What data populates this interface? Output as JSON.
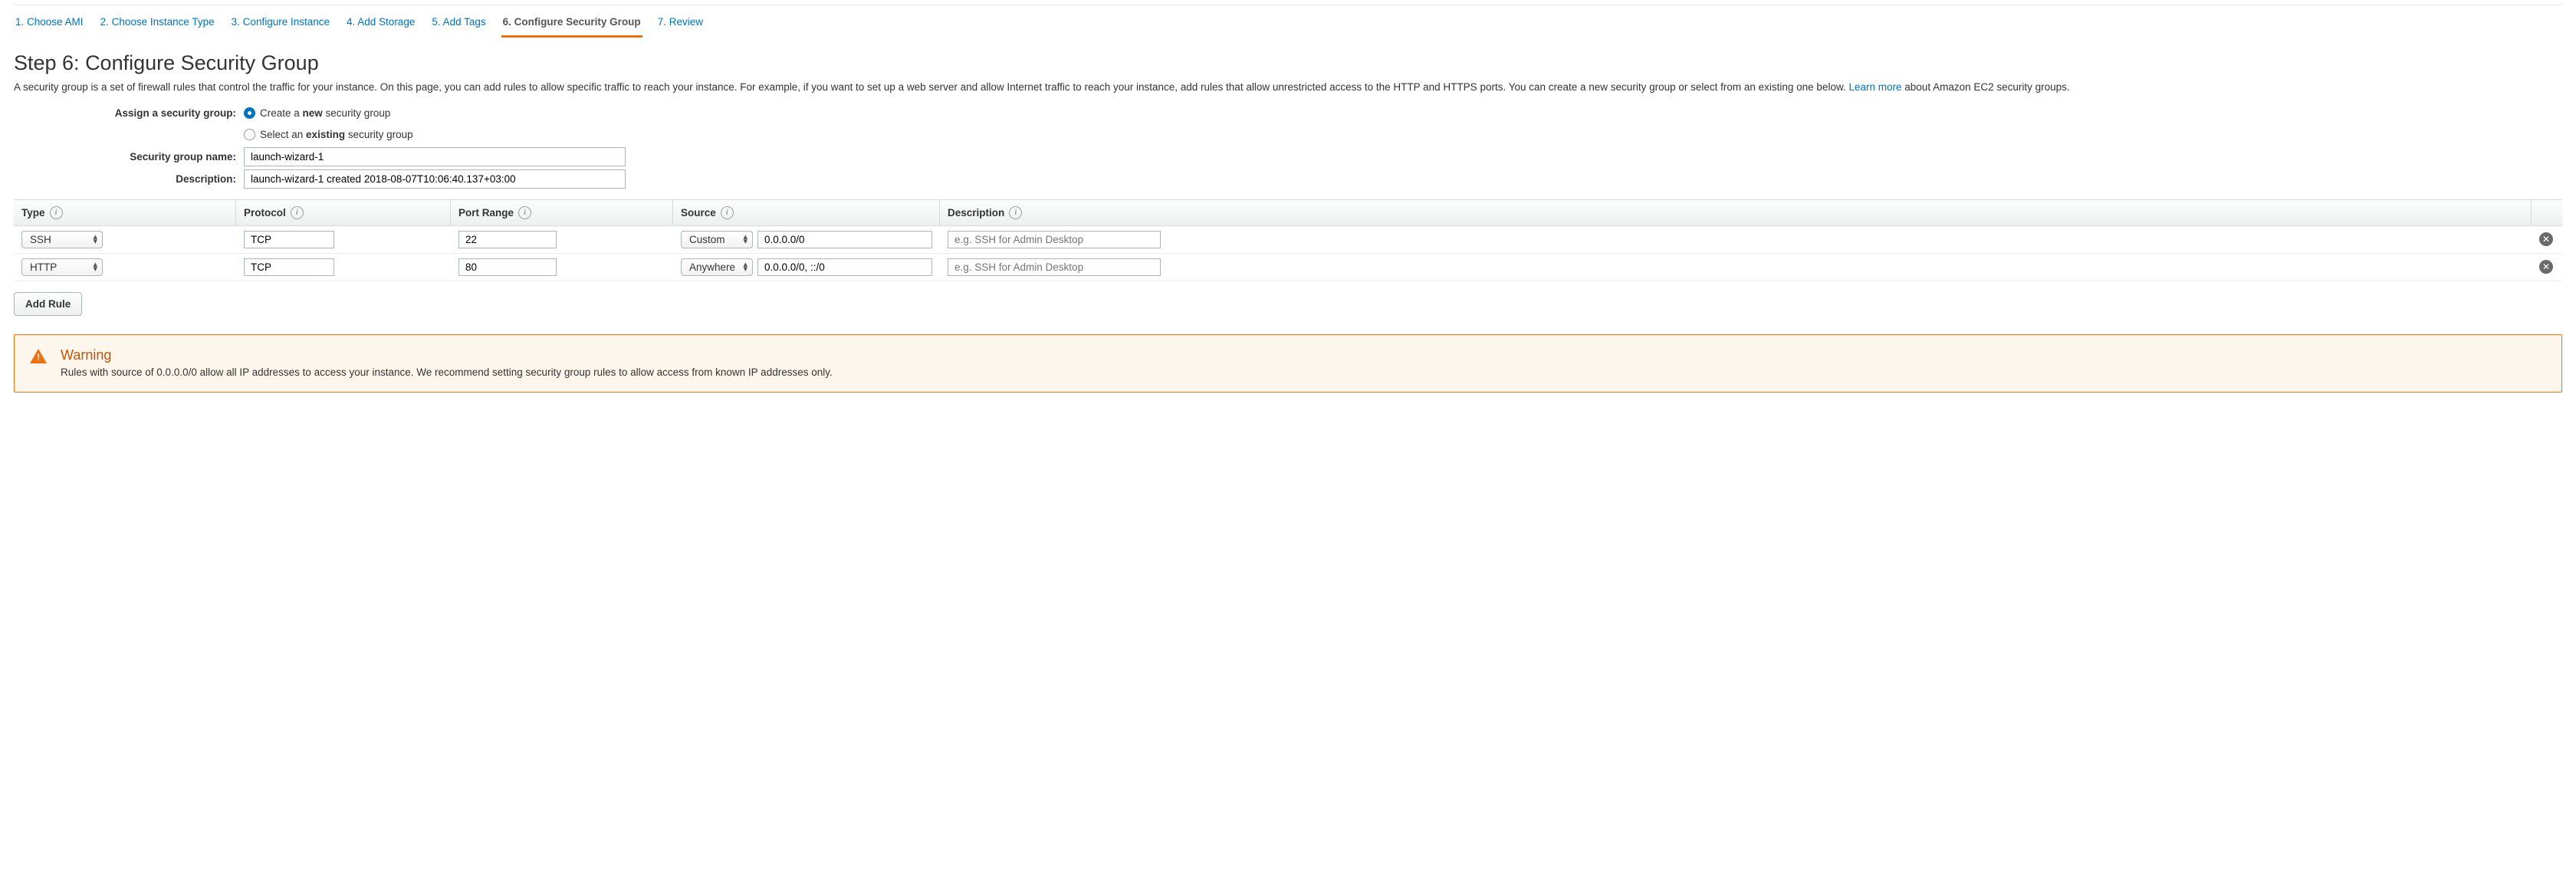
{
  "stepper": {
    "steps": [
      {
        "label": "1. Choose AMI"
      },
      {
        "label": "2. Choose Instance Type"
      },
      {
        "label": "3. Configure Instance"
      },
      {
        "label": "4. Add Storage"
      },
      {
        "label": "5. Add Tags"
      },
      {
        "label": "6. Configure Security Group"
      },
      {
        "label": "7. Review"
      }
    ],
    "active_index": 5
  },
  "heading": "Step 6: Configure Security Group",
  "description_pre": "A security group is a set of firewall rules that control the traffic for your instance. On this page, you can add rules to allow specific traffic to reach your instance. For example, if you want to set up a web server and allow Internet traffic to reach your instance, add rules that allow unrestricted access to the HTTP and HTTPS ports. You can create a new security group or select from an existing one below. ",
  "description_link": "Learn more",
  "description_post": " about Amazon EC2 security groups.",
  "form": {
    "assign_label": "Assign a security group:",
    "radio_create_pre": "Create a ",
    "radio_create_bold": "new",
    "radio_create_post": " security group",
    "radio_existing_pre": "Select an ",
    "radio_existing_bold": "existing",
    "radio_existing_post": " security group",
    "name_label": "Security group name:",
    "name_value": "launch-wizard-1",
    "desc_label": "Description:",
    "desc_value": "launch-wizard-1 created 2018-08-07T10:06:40.137+03:00"
  },
  "table": {
    "headers": {
      "type": "Type",
      "protocol": "Protocol",
      "port": "Port Range",
      "source": "Source",
      "description": "Description"
    },
    "rows": [
      {
        "type": "SSH",
        "protocol": "TCP",
        "port": "22",
        "source_mode": "Custom",
        "source_value": "0.0.0.0/0",
        "desc_placeholder": "e.g. SSH for Admin Desktop"
      },
      {
        "type": "HTTP",
        "protocol": "TCP",
        "port": "80",
        "source_mode": "Anywhere",
        "source_value": "0.0.0.0/0, ::/0",
        "desc_placeholder": "e.g. SSH for Admin Desktop"
      }
    ],
    "add_rule_label": "Add Rule"
  },
  "warning": {
    "title": "Warning",
    "text": "Rules with source of 0.0.0.0/0 allow all IP addresses to access your instance. We recommend setting security group rules to allow access from known IP addresses only."
  }
}
